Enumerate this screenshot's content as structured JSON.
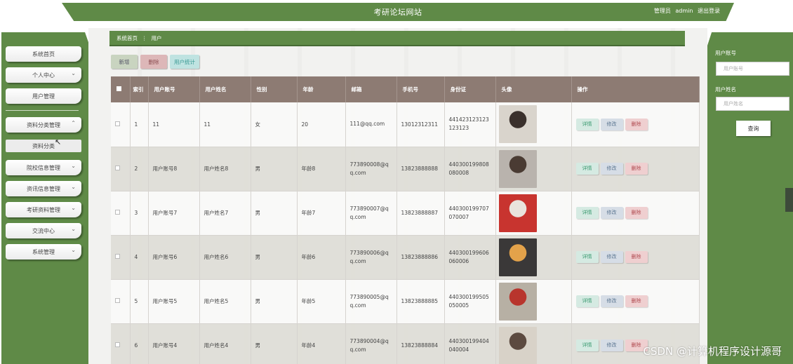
{
  "header": {
    "site_title": "考研论坛网站",
    "user_role": "管理员",
    "username": "admin",
    "logout": "退出登录"
  },
  "sidebar": {
    "items": [
      {
        "label": "系统首页",
        "has_chevron": false
      },
      {
        "label": "个人中心",
        "has_chevron": true
      },
      {
        "label": "用户管理",
        "has_chevron": false
      },
      {
        "label": "资料分类管理",
        "has_chevron": true,
        "expanded": true
      },
      {
        "label": "资料分类",
        "sub": true
      },
      {
        "label": "院校信息管理",
        "has_chevron": true
      },
      {
        "label": "资讯信息管理",
        "has_chevron": true
      },
      {
        "label": "考研资料管理",
        "has_chevron": true
      },
      {
        "label": "交流中心",
        "has_chevron": true
      },
      {
        "label": "系统管理",
        "has_chevron": true
      }
    ]
  },
  "breadcrumb": {
    "home": "系统首页",
    "separator": "⋮",
    "current": "用户"
  },
  "actions": {
    "add": "新增",
    "delete": "删除",
    "stats": "用户统计"
  },
  "table": {
    "columns": [
      "索引",
      "用户账号",
      "用户姓名",
      "性别",
      "年龄",
      "邮箱",
      "手机号",
      "身份证",
      "头像",
      "操作"
    ],
    "rows": [
      {
        "index": "1",
        "account": "11",
        "name": "11",
        "gender": "女",
        "age": "20",
        "email": "111@qq.com",
        "phone": "13012312311",
        "idcard": "441423123123123123",
        "avatar_colors": [
          "#d9d4cc",
          "#3a302c"
        ]
      },
      {
        "index": "2",
        "account": "用户账号8",
        "name": "用户姓名8",
        "gender": "男",
        "age": "年龄8",
        "email": "773890008@qq.com",
        "phone": "13823888888",
        "idcard": "440300199808080008",
        "avatar_colors": [
          "#b9b3ad",
          "#4a3b33"
        ]
      },
      {
        "index": "3",
        "account": "用户账号7",
        "name": "用户姓名7",
        "gender": "男",
        "age": "年龄7",
        "email": "773890007@qq.com",
        "phone": "13823888887",
        "idcard": "440300199707070007",
        "avatar_colors": [
          "#c8342f",
          "#e9e3dc"
        ]
      },
      {
        "index": "4",
        "account": "用户账号6",
        "name": "用户姓名6",
        "gender": "男",
        "age": "年龄6",
        "email": "773890006@qq.com",
        "phone": "13823888886",
        "idcard": "440300199606060006",
        "avatar_colors": [
          "#3a3838",
          "#e3a24a"
        ]
      },
      {
        "index": "5",
        "account": "用户账号5",
        "name": "用户姓名5",
        "gender": "男",
        "age": "年龄5",
        "email": "773890005@qq.com",
        "phone": "13823888885",
        "idcard": "440300199505050005",
        "avatar_colors": [
          "#b7b0a4",
          "#b8352d"
        ]
      },
      {
        "index": "6",
        "account": "用户账号4",
        "name": "用户姓名4",
        "gender": "男",
        "age": "年龄4",
        "email": "773890004@qq.com",
        "phone": "13823888884",
        "idcard": "440300199404040004",
        "avatar_colors": [
          "#d8d2c8",
          "#5c4a40"
        ]
      }
    ],
    "row_actions": {
      "detail": "详情",
      "edit": "修改",
      "delete": "删除"
    }
  },
  "search_panel": {
    "account_label": "用户账号",
    "account_placeholder": "用户账号",
    "name_label": "用户姓名",
    "name_placeholder": "用户姓名",
    "search_button": "查询"
  },
  "watermark": "CSDN @计算机程序设计源哥",
  "colors": {
    "brand_green": "#5f8a47",
    "table_header": "#8d7b73",
    "btn_add": "#c9d4c0",
    "btn_delete": "#ddb7b8",
    "btn_stats": "#bfe3e1"
  }
}
